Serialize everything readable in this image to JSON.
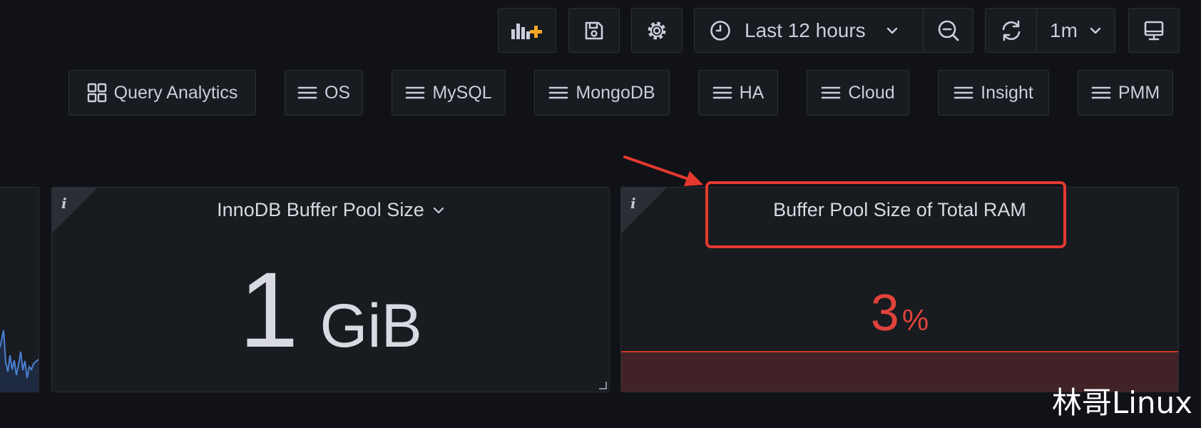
{
  "toolbar": {
    "add_panel_icon": "add-panel-icon",
    "save_icon": "save-icon",
    "settings_icon": "gear-icon",
    "time_range_label": "Last 12 hours",
    "refresh_interval_label": "1m",
    "accent_color": "#f5a623"
  },
  "links": [
    {
      "label": "Query Analytics",
      "icon": "apps-grid-icon"
    },
    {
      "label": "OS",
      "icon": "menu-icon"
    },
    {
      "label": "MySQL",
      "icon": "menu-icon"
    },
    {
      "label": "MongoDB",
      "icon": "menu-icon"
    },
    {
      "label": "HA",
      "icon": "menu-icon"
    },
    {
      "label": "Cloud",
      "icon": "menu-icon"
    },
    {
      "label": "Insight",
      "icon": "menu-icon"
    },
    {
      "label": "PMM",
      "icon": "menu-icon"
    }
  ],
  "panels": {
    "innodb": {
      "title": "InnoDB Buffer Pool Size",
      "value": "1",
      "unit": "GiB",
      "info_label": "i"
    },
    "ram": {
      "title": "Buffer Pool Size of Total RAM",
      "value": "3",
      "unit": "%",
      "info_label": "i",
      "value_color": "#e0423a",
      "fill_color": "#412327"
    }
  },
  "annotation": {
    "color": "#e5392f"
  },
  "watermark": "林哥Linux"
}
